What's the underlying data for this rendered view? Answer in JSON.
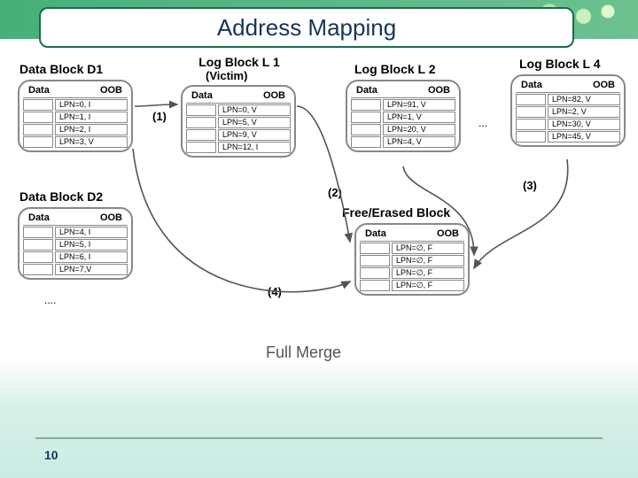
{
  "title": "Address Mapping",
  "caption": "Full  Merge",
  "page_number": "10",
  "ellipsis_bottom": "....",
  "ellipsis_right": "...",
  "columns": {
    "data": "Data",
    "oob": "OOB"
  },
  "steps": {
    "s1": "(1)",
    "s2": "(2)",
    "s3": "(3)",
    "s4": "(4)"
  },
  "blocks": {
    "d1": {
      "title": "Data Block D1",
      "rows": [
        "LPN=0, I",
        "LPN=1, I",
        "LPN=2, I",
        "LPN=3, V"
      ]
    },
    "d2": {
      "title": "Data Block D2",
      "rows": [
        "LPN=4, I",
        "LPN=5, I",
        "LPN=6, I",
        "LPN=7,V"
      ]
    },
    "l1": {
      "title": "Log Block L 1",
      "subtitle": "(Victim)",
      "rows": [
        "LPN=0, V",
        "LPN=5, V",
        "LPN=9, V",
        "LPN=12, I"
      ]
    },
    "l2": {
      "title": "Log Block L 2",
      "rows": [
        "LPN=91, V",
        "LPN=1, V",
        "LPN=20, V",
        "LPN=4, V"
      ]
    },
    "l4": {
      "title": "Log Block L 4",
      "rows": [
        "LPN=82, V",
        "LPN=2, V",
        "LPN=30, V",
        "LPN=45, V"
      ]
    },
    "free": {
      "title": "Free/Erased Block",
      "rows": [
        "LPN=∅, F",
        "LPN=∅, F",
        "LPN=∅, F",
        "LPN=∅, F"
      ]
    }
  }
}
